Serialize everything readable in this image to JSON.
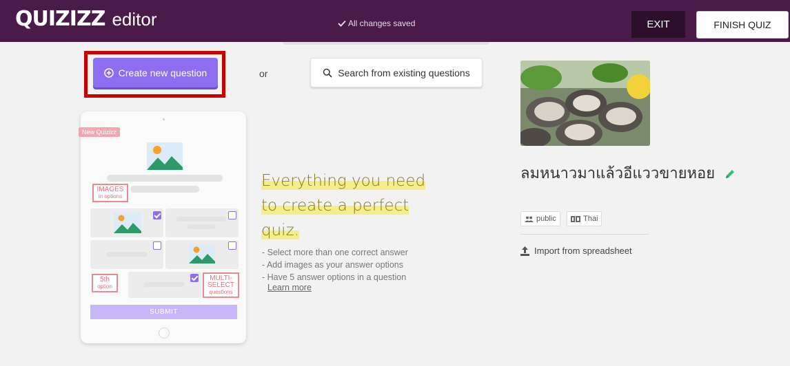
{
  "header": {
    "logo_text": "QUIZIZZ",
    "editor_label": "editor",
    "save_status": "All changes saved",
    "exit_label": "EXIT",
    "finish_label": "FINISH QUIZ"
  },
  "actions": {
    "create_label": "Create new question",
    "or_label": "or",
    "search_label": "Search from existing questions"
  },
  "promo": {
    "badge": "New Quizizz",
    "images_label": "IMAGES",
    "images_sub": "in options",
    "fifth_label": "5th",
    "fifth_sub": "option",
    "multi_label": "MULTI-SELECT",
    "multi_sub": "questions",
    "submit_label": "SUBMIT",
    "headline_1": "Everything you need",
    "headline_2": "to create a perfect",
    "headline_3": "quiz.",
    "bullets": [
      "- Select more than one correct answer",
      "- Add images as your answer options",
      "- Have 5 answer options in a question"
    ],
    "learn_more": "Learn more"
  },
  "quiz": {
    "title": "ลมหนาวมาแล้วอีแววขายหอย",
    "visibility": "public",
    "language": "Thai",
    "import_label": "Import from spreadsheet"
  },
  "colors": {
    "header_bg": "#4a1a49",
    "accent_purple": "#8d6ef0",
    "highlight_red": "#c80000",
    "edit_green": "#2fc46a"
  }
}
